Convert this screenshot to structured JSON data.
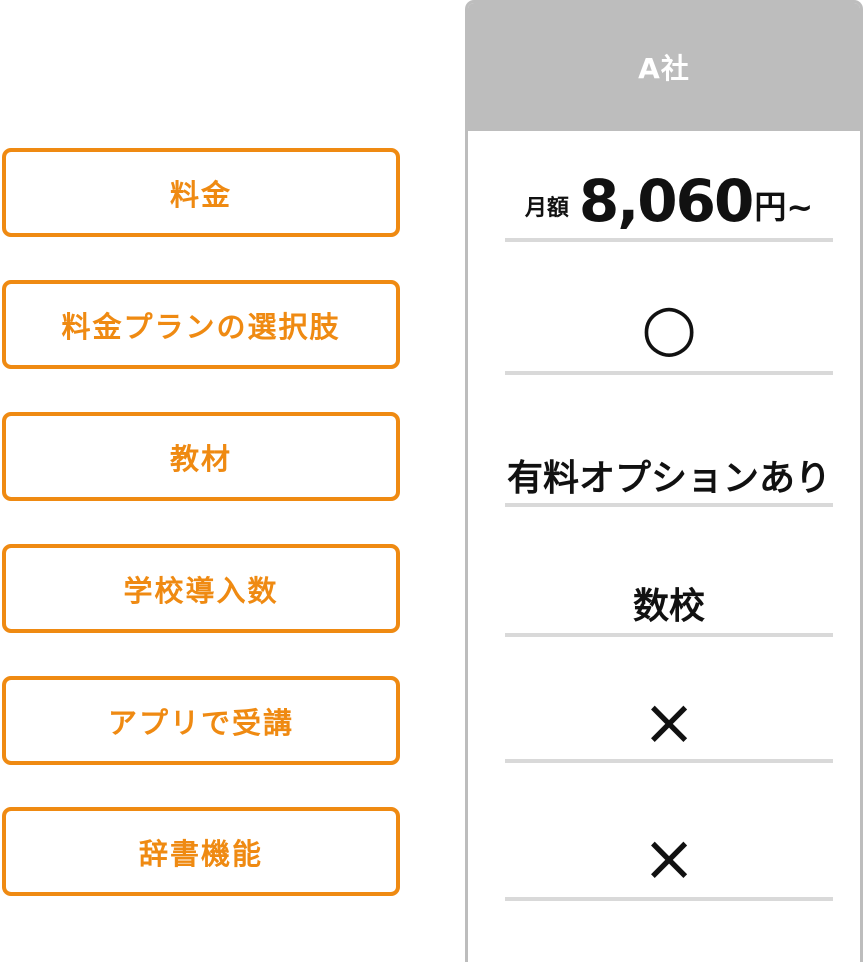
{
  "labels": [
    "料金",
    "料金プランの選択肢",
    "教材",
    "学校導入数",
    "アプリで受講",
    "辞書機能"
  ],
  "company": {
    "name": "A社",
    "price": {
      "prefix": "月額",
      "amount": "8,060",
      "suffix": "円~"
    },
    "plans": "○",
    "materials": "有料オプションあり",
    "schools": "数校",
    "app": "×",
    "dictionary": "×"
  },
  "colors": {
    "accent": "#ef8a12",
    "header_bg": "#bdbdbd",
    "divider": "#d9d9d9"
  }
}
